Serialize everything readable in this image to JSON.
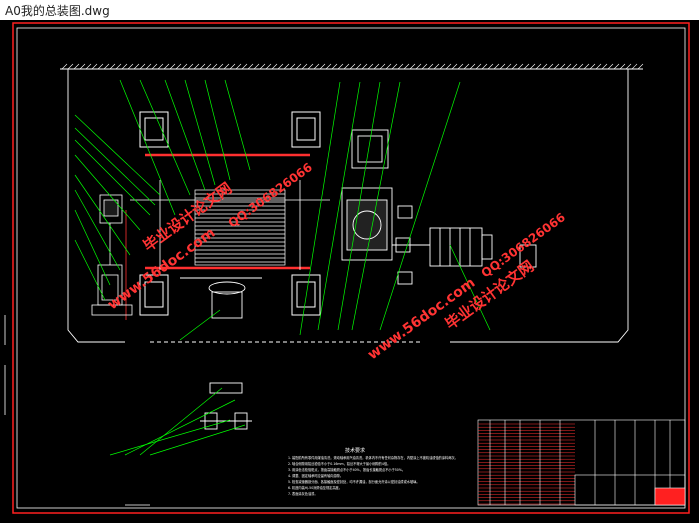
{
  "window": {
    "title": "A0我的总装图.dwg"
  },
  "drawing": {
    "background": "#000000",
    "frame_color": "#ff2020",
    "line_color": "#ffffff",
    "leader_color": "#00ff00",
    "accent_color": "#ff3030",
    "notes_title": "技术要求",
    "tech_notes": [
      "1. 装配前所有零件用煤油清洗，滚动轴承用汽油清洗，机体内不许有任何杂物存在，内壁涂上不被机油浸蚀的涂料两次。",
      "2. 啮合侧隙用铅丝检验不小于0.16mm，铅丝不得大于最小侧隙的4倍。",
      "3. 用涂色法检验斑点，按齿高接触斑点不小于40%，按齿长接触斑点不小于50%。",
      "4. 调整、固定轴承时应留有轴向游隙。",
      "5. 检查减速器剖分面、各接触面及密封处，均不许漏油，剖分面允许涂以密封油漆或水玻璃。",
      "6. 机座内装HJ-50润滑油至规定高度。",
      "7. 表面涂灰色油漆。"
    ]
  },
  "watermarks": {
    "site_text": "www.56doc.com",
    "brand_text": "毕业设计论文网",
    "qq_text": "QQ:306826066",
    "color": "#ff3333"
  }
}
